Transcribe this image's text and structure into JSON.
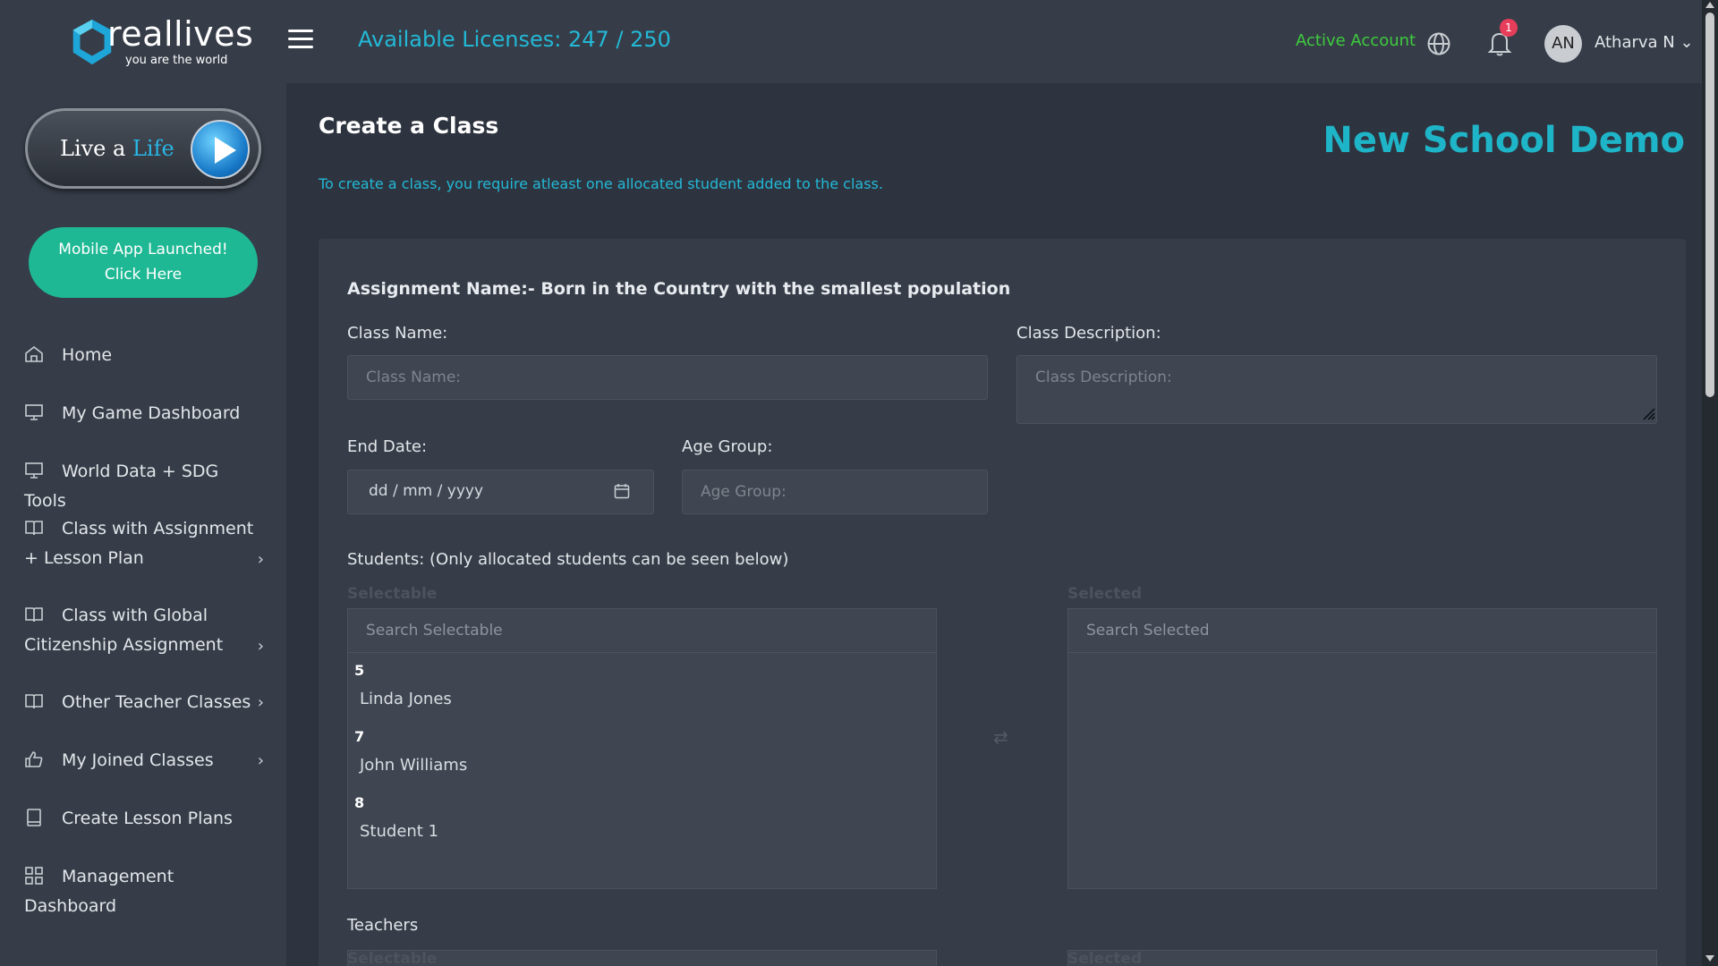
{
  "brand": {
    "logo_word": "reallives",
    "logo_tagline": "you are the world"
  },
  "sidebar": {
    "live_button": {
      "prefix": "Live a ",
      "highlight": "Life"
    },
    "app_button": {
      "line1": "Mobile App Launched!",
      "line2": "Click Here"
    },
    "items": [
      {
        "label": "Home",
        "icon": "home-icon"
      },
      {
        "label": "My Game Dashboard",
        "icon": "monitor-icon"
      },
      {
        "label": "World Data + SDG Tools",
        "icon": "monitor-icon"
      },
      {
        "label": "Class with Assignment",
        "label2": "+ Lesson Plan",
        "icon": "book-icon",
        "has_chevron": true
      },
      {
        "label": "Class with Global",
        "label2": "Citizenship Assignment",
        "icon": "book-icon",
        "has_chevron": true
      },
      {
        "label": "Other Teacher Classes",
        "icon": "book-icon",
        "has_chevron": true
      },
      {
        "label": "My Joined Classes",
        "icon": "thumbs-up-icon",
        "has_chevron": true
      },
      {
        "label": "Create Lesson Plans",
        "icon": "tablet-icon"
      },
      {
        "label": "Management",
        "label2": "Dashboard",
        "icon": "grid-icon"
      }
    ],
    "chevron": "›"
  },
  "topbar": {
    "licenses": "Available Licenses: 247 / 250",
    "account_status": "Active Account",
    "notification_count": "1",
    "avatar_initials": "AN",
    "user_name": "Atharva N",
    "user_caret": "⌄"
  },
  "main": {
    "title": "Create a Class",
    "school": "New School Demo",
    "hint": "To create a class, you require atleast one allocated student added to the class.",
    "assignment": "Assignment Name:- Born in the Country with the smallest population",
    "class_name": {
      "label": "Class Name:",
      "placeholder": "Class Name:"
    },
    "class_description": {
      "label": "Class Description:",
      "placeholder": "Class Description:"
    },
    "end_date": {
      "label": "End Date:",
      "value": "dd / mm / yyyy"
    },
    "age_group": {
      "label": "Age Group:",
      "placeholder": "Age Group:"
    },
    "students": {
      "label": "Students: (Only allocated students can be seen below)",
      "selectable_header": "Selectable",
      "selected_header": "Selected",
      "search_selectable": "Search Selectable",
      "search_selected": "Search Selected",
      "options": [
        {
          "id": "5",
          "name": "Linda Jones"
        },
        {
          "id": "7",
          "name": "John Williams"
        },
        {
          "id": "8",
          "name": "Student 1"
        }
      ],
      "swap_glyph": "⇄"
    },
    "teachers": {
      "label": "Teachers",
      "selectable_header": "Selectable",
      "selected_header": "Selected"
    }
  },
  "colors": {
    "accent": "#23b8d6",
    "school": "#1fb5c8",
    "active": "#3ecb3e",
    "app_button": "#1fb894",
    "badge": "#e63d5a"
  }
}
